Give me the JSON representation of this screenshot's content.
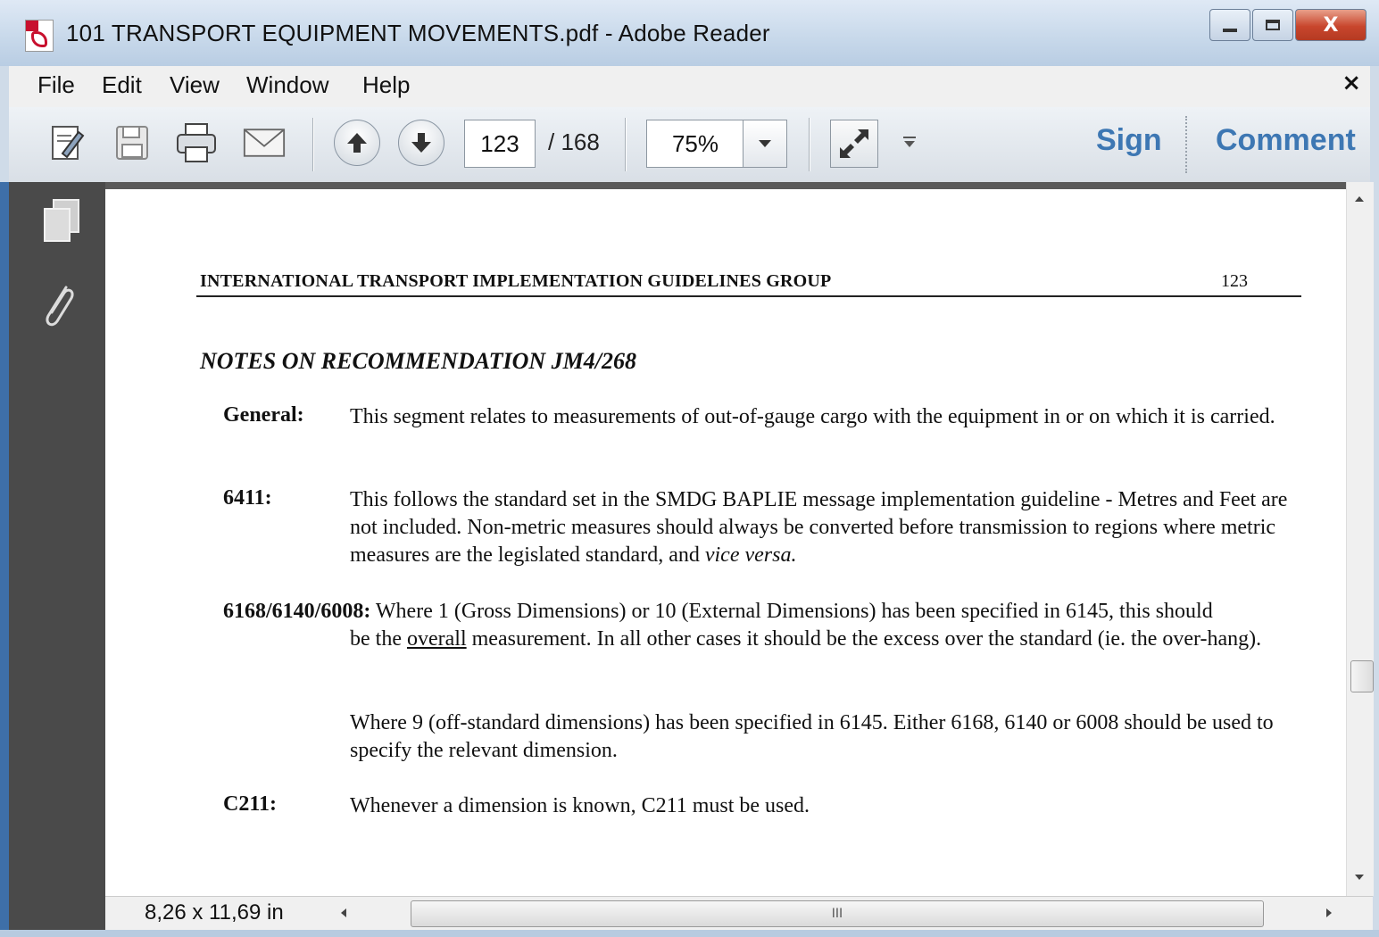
{
  "window": {
    "title": "101 TRANSPORT EQUIPMENT MOVEMENTS.pdf - Adobe Reader",
    "close_glyph": "X"
  },
  "menu": {
    "items": [
      "File",
      "Edit",
      "View",
      "Window",
      "Help"
    ],
    "close_glyph": "×"
  },
  "toolbar": {
    "current_page": "123",
    "page_total": "/ 168",
    "zoom": "75%",
    "sign_label": "Sign",
    "comment_label": "Comment",
    "icons": [
      "edit-icon",
      "save-icon",
      "print-icon",
      "email-icon",
      "page-up-icon",
      "page-down-icon",
      "fit-expand-icon",
      "more-tools-icon"
    ]
  },
  "status": {
    "page_size": "8,26 x 11,69 in",
    "scroll_grip": "III"
  },
  "page": {
    "header_left": "INTERNATIONAL TRANSPORT IMPLEMENTATION GUIDELINES GROUP",
    "header_right": "123",
    "notes_title": "NOTES ON RECOMMENDATION JM4/268",
    "general_label": "General:",
    "general_text": "This segment relates to measurements of out-of-gauge cargo with the equipment in or on which it is carried.",
    "s6411_label": "6411:",
    "s6411_text_a": "This follows the standard set in the SMDG BAPLIE message implementation guideline - Metres and Feet are not included.  Non-metric measures should always be converted before transmission to regions where metric measures are the legislated standard, and ",
    "s6411_text_italic": "vice versa.",
    "s6168_label": "6168/6140/6008:",
    "s6168_text_a": " Where 1 (Gross Dimensions) or 10 (External Dimensions) has been specified in 6145, this should",
    "s6168_text_b_pre": "be the ",
    "s6168_text_b_underline": "overall",
    "s6168_text_b_post": " measurement.  In all other cases it should be the excess over the standard (ie. the over-hang).",
    "s6168_text_c": "Where 9 (off-standard dimensions) has been specified in 6145. Either 6168, 6140 or 6008 should be used to specify the relevant dimension.",
    "c211_label": "C211:",
    "c211_text": "Whenever a dimension is known, C211 must be used."
  }
}
